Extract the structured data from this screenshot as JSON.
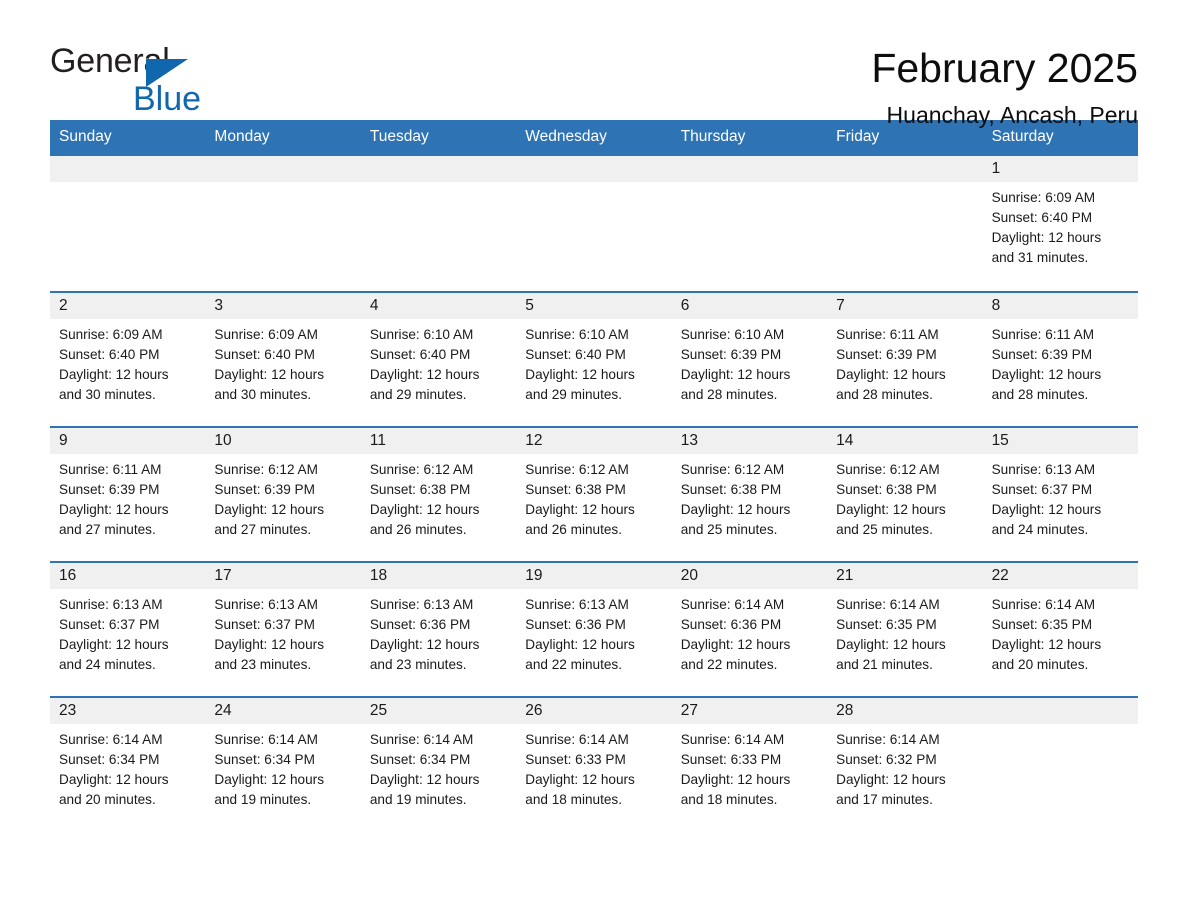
{
  "brand": {
    "name_part1": "General",
    "name_part2": "Blue",
    "triangle_color": "#1167ad",
    "text_color": "#231f20"
  },
  "header": {
    "title": "February 2025",
    "subtitle": "Huanchay, Ancash, Peru"
  },
  "theme": {
    "header_blue": "#2e74b5",
    "daynum_band": "#f0f0f0",
    "text": "#1a1a1a"
  },
  "weekdays": [
    "Sunday",
    "Monday",
    "Tuesday",
    "Wednesday",
    "Thursday",
    "Friday",
    "Saturday"
  ],
  "weeks": [
    {
      "days": [
        {
          "num": "",
          "info": ""
        },
        {
          "num": "",
          "info": ""
        },
        {
          "num": "",
          "info": ""
        },
        {
          "num": "",
          "info": ""
        },
        {
          "num": "",
          "info": ""
        },
        {
          "num": "",
          "info": ""
        },
        {
          "num": "1",
          "info": "Sunrise: 6:09 AM\nSunset: 6:40 PM\nDaylight: 12 hours\nand 31 minutes."
        }
      ]
    },
    {
      "days": [
        {
          "num": "2",
          "info": "Sunrise: 6:09 AM\nSunset: 6:40 PM\nDaylight: 12 hours\nand 30 minutes."
        },
        {
          "num": "3",
          "info": "Sunrise: 6:09 AM\nSunset: 6:40 PM\nDaylight: 12 hours\nand 30 minutes."
        },
        {
          "num": "4",
          "info": "Sunrise: 6:10 AM\nSunset: 6:40 PM\nDaylight: 12 hours\nand 29 minutes."
        },
        {
          "num": "5",
          "info": "Sunrise: 6:10 AM\nSunset: 6:40 PM\nDaylight: 12 hours\nand 29 minutes."
        },
        {
          "num": "6",
          "info": "Sunrise: 6:10 AM\nSunset: 6:39 PM\nDaylight: 12 hours\nand 28 minutes."
        },
        {
          "num": "7",
          "info": "Sunrise: 6:11 AM\nSunset: 6:39 PM\nDaylight: 12 hours\nand 28 minutes."
        },
        {
          "num": "8",
          "info": "Sunrise: 6:11 AM\nSunset: 6:39 PM\nDaylight: 12 hours\nand 28 minutes."
        }
      ]
    },
    {
      "days": [
        {
          "num": "9",
          "info": "Sunrise: 6:11 AM\nSunset: 6:39 PM\nDaylight: 12 hours\nand 27 minutes."
        },
        {
          "num": "10",
          "info": "Sunrise: 6:12 AM\nSunset: 6:39 PM\nDaylight: 12 hours\nand 27 minutes."
        },
        {
          "num": "11",
          "info": "Sunrise: 6:12 AM\nSunset: 6:38 PM\nDaylight: 12 hours\nand 26 minutes."
        },
        {
          "num": "12",
          "info": "Sunrise: 6:12 AM\nSunset: 6:38 PM\nDaylight: 12 hours\nand 26 minutes."
        },
        {
          "num": "13",
          "info": "Sunrise: 6:12 AM\nSunset: 6:38 PM\nDaylight: 12 hours\nand 25 minutes."
        },
        {
          "num": "14",
          "info": "Sunrise: 6:12 AM\nSunset: 6:38 PM\nDaylight: 12 hours\nand 25 minutes."
        },
        {
          "num": "15",
          "info": "Sunrise: 6:13 AM\nSunset: 6:37 PM\nDaylight: 12 hours\nand 24 minutes."
        }
      ]
    },
    {
      "days": [
        {
          "num": "16",
          "info": "Sunrise: 6:13 AM\nSunset: 6:37 PM\nDaylight: 12 hours\nand 24 minutes."
        },
        {
          "num": "17",
          "info": "Sunrise: 6:13 AM\nSunset: 6:37 PM\nDaylight: 12 hours\nand 23 minutes."
        },
        {
          "num": "18",
          "info": "Sunrise: 6:13 AM\nSunset: 6:36 PM\nDaylight: 12 hours\nand 23 minutes."
        },
        {
          "num": "19",
          "info": "Sunrise: 6:13 AM\nSunset: 6:36 PM\nDaylight: 12 hours\nand 22 minutes."
        },
        {
          "num": "20",
          "info": "Sunrise: 6:14 AM\nSunset: 6:36 PM\nDaylight: 12 hours\nand 22 minutes."
        },
        {
          "num": "21",
          "info": "Sunrise: 6:14 AM\nSunset: 6:35 PM\nDaylight: 12 hours\nand 21 minutes."
        },
        {
          "num": "22",
          "info": "Sunrise: 6:14 AM\nSunset: 6:35 PM\nDaylight: 12 hours\nand 20 minutes."
        }
      ]
    },
    {
      "days": [
        {
          "num": "23",
          "info": "Sunrise: 6:14 AM\nSunset: 6:34 PM\nDaylight: 12 hours\nand 20 minutes."
        },
        {
          "num": "24",
          "info": "Sunrise: 6:14 AM\nSunset: 6:34 PM\nDaylight: 12 hours\nand 19 minutes."
        },
        {
          "num": "25",
          "info": "Sunrise: 6:14 AM\nSunset: 6:34 PM\nDaylight: 12 hours\nand 19 minutes."
        },
        {
          "num": "26",
          "info": "Sunrise: 6:14 AM\nSunset: 6:33 PM\nDaylight: 12 hours\nand 18 minutes."
        },
        {
          "num": "27",
          "info": "Sunrise: 6:14 AM\nSunset: 6:33 PM\nDaylight: 12 hours\nand 18 minutes."
        },
        {
          "num": "28",
          "info": "Sunrise: 6:14 AM\nSunset: 6:32 PM\nDaylight: 12 hours\nand 17 minutes."
        },
        {
          "num": "",
          "info": ""
        }
      ]
    }
  ]
}
